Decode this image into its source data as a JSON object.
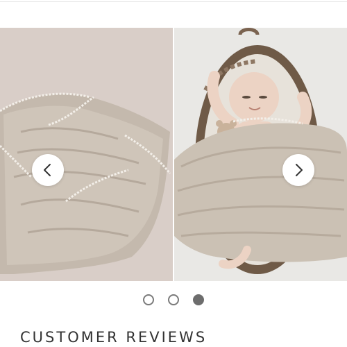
{
  "carousel": {
    "slides": [
      {
        "alt": ""
      },
      {
        "alt": ""
      }
    ],
    "prev_icon": "chevron-left-icon",
    "next_icon": "chevron-right-icon",
    "dots_count": 3,
    "active_dot": 3
  },
  "reviews": {
    "title": "CUSTOMER REVIEWS"
  },
  "colors": {
    "swaddle": "#c9bfb3",
    "pink_background": "#d9cec8",
    "basket": "#6f5a47",
    "dot_active": "#6d6d6d"
  }
}
